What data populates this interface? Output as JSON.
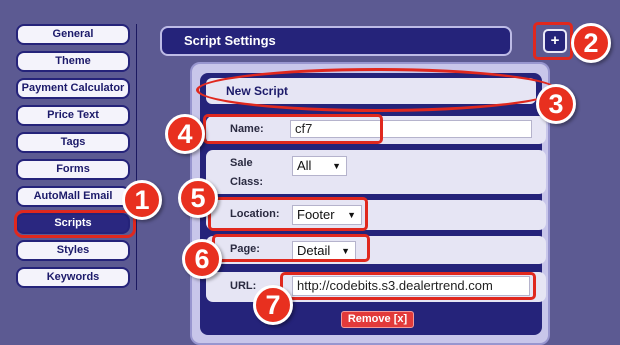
{
  "sidebar": {
    "items": [
      {
        "label": "General"
      },
      {
        "label": "Theme"
      },
      {
        "label": "Payment Calculator"
      },
      {
        "label": "Price Text"
      },
      {
        "label": "Tags"
      },
      {
        "label": "Forms"
      },
      {
        "label": "AutoMall Email"
      },
      {
        "label": "Scripts"
      },
      {
        "label": "Styles"
      },
      {
        "label": "Keywords"
      }
    ],
    "active": "Scripts"
  },
  "header": {
    "title": "Script Settings",
    "add_label": "+"
  },
  "script": {
    "title": "New Script",
    "name_label": "Name:",
    "name_value": "cf7",
    "sale_class_label_1": "Sale",
    "sale_class_label_2": "Class:",
    "sale_class_value": "All",
    "location_label": "Location:",
    "location_value": "Footer",
    "page_label": "Page:",
    "page_value": "Detail",
    "url_label": "URL:",
    "url_value": "http://codebits.s3.dealertrend.com",
    "remove_label": "Remove [x]",
    "caret": "▼"
  },
  "annotations": [
    "1",
    "2",
    "3",
    "4",
    "5",
    "6",
    "7"
  ],
  "colors": {
    "accent": "#25237a",
    "highlight": "#e0281e",
    "background": "#5c5a92"
  }
}
